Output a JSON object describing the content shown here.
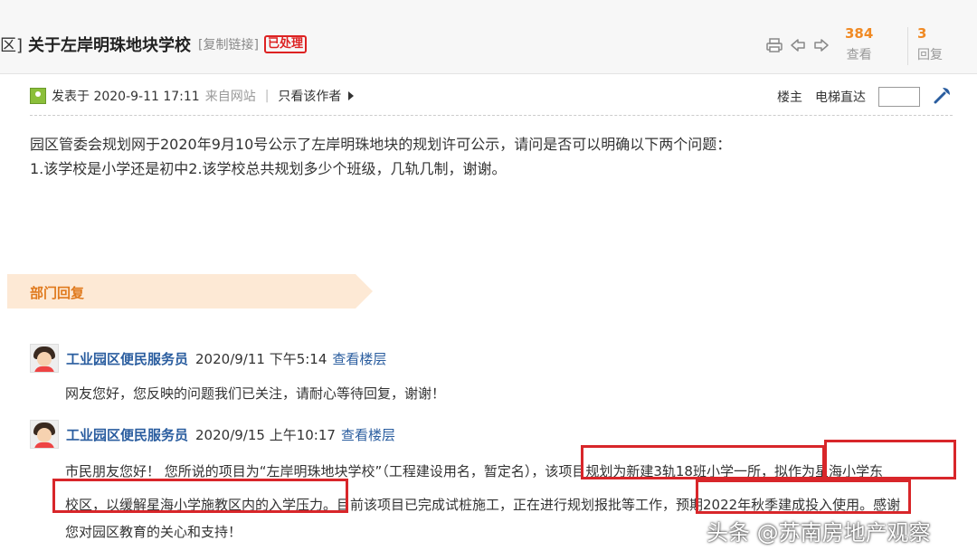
{
  "header": {
    "title_prefix": "区]",
    "title": "关于左岸明珠地块学校",
    "copy_link": "[复制链接]",
    "status": "已处理",
    "views": {
      "count": "384",
      "label": "查看"
    },
    "replies": {
      "count": "3",
      "label": "回复"
    }
  },
  "post": {
    "published": "发表于 2020-9-11 17:11",
    "source": "来自网站",
    "only_author": "只看该作者",
    "owner": "楼主",
    "jump": "电梯直达",
    "question_line1": "园区管委会规划网于2020年9月10号公示了左岸明珠地块的规划许可公示，请问是否可以明确以下两个问题：",
    "question_line2": "1.该学校是小学还是初中2.该学校总共规划多少个班级，几轨几制，谢谢。"
  },
  "dept_reply": {
    "label": "部门回复"
  },
  "replies": [
    {
      "author": "工业园区便民服务员",
      "time": "2020/9/11 下午5:14",
      "link": "查看楼层",
      "body": "网友您好，您反映的问题我们已关注，请耐心等待回复，谢谢！"
    },
    {
      "author": "工业园区便民服务员",
      "time": "2020/9/15 上午10:17",
      "link": "查看楼层",
      "line1": "市民朋友您好！ 您所说的项目为“左岸明珠地块学校”（工程建设用名，暂定名），该项目规划为新建3轨18班小学一所，拟作为星海小学东",
      "line2": "校区，以缓解星海小学施教区内的入学压力。目前该项目已完成试桩施工，正在进行规划报批等工作，预期2022年秋季建成投入使用。感谢",
      "line3": "您对园区教育的关心和支持！"
    }
  ],
  "watermark": "头条 @苏南房地产观察",
  "colors": {
    "accent": "#f08a24",
    "link": "#2a5d9f",
    "highlight": "#d8262a",
    "banner": "#fde9d5"
  }
}
